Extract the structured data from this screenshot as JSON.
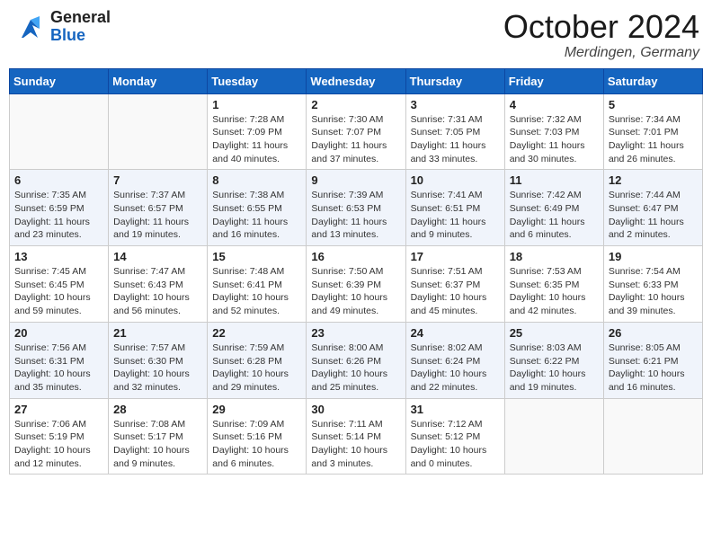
{
  "header": {
    "logo_general": "General",
    "logo_blue": "Blue",
    "month_title": "October 2024",
    "location": "Merdingen, Germany"
  },
  "days_of_week": [
    "Sunday",
    "Monday",
    "Tuesday",
    "Wednesday",
    "Thursday",
    "Friday",
    "Saturday"
  ],
  "weeks": [
    {
      "days": [
        {
          "num": "",
          "content": ""
        },
        {
          "num": "",
          "content": ""
        },
        {
          "num": "1",
          "content": "Sunrise: 7:28 AM\nSunset: 7:09 PM\nDaylight: 11 hours and 40 minutes."
        },
        {
          "num": "2",
          "content": "Sunrise: 7:30 AM\nSunset: 7:07 PM\nDaylight: 11 hours and 37 minutes."
        },
        {
          "num": "3",
          "content": "Sunrise: 7:31 AM\nSunset: 7:05 PM\nDaylight: 11 hours and 33 minutes."
        },
        {
          "num": "4",
          "content": "Sunrise: 7:32 AM\nSunset: 7:03 PM\nDaylight: 11 hours and 30 minutes."
        },
        {
          "num": "5",
          "content": "Sunrise: 7:34 AM\nSunset: 7:01 PM\nDaylight: 11 hours and 26 minutes."
        }
      ]
    },
    {
      "days": [
        {
          "num": "6",
          "content": "Sunrise: 7:35 AM\nSunset: 6:59 PM\nDaylight: 11 hours and 23 minutes."
        },
        {
          "num": "7",
          "content": "Sunrise: 7:37 AM\nSunset: 6:57 PM\nDaylight: 11 hours and 19 minutes."
        },
        {
          "num": "8",
          "content": "Sunrise: 7:38 AM\nSunset: 6:55 PM\nDaylight: 11 hours and 16 minutes."
        },
        {
          "num": "9",
          "content": "Sunrise: 7:39 AM\nSunset: 6:53 PM\nDaylight: 11 hours and 13 minutes."
        },
        {
          "num": "10",
          "content": "Sunrise: 7:41 AM\nSunset: 6:51 PM\nDaylight: 11 hours and 9 minutes."
        },
        {
          "num": "11",
          "content": "Sunrise: 7:42 AM\nSunset: 6:49 PM\nDaylight: 11 hours and 6 minutes."
        },
        {
          "num": "12",
          "content": "Sunrise: 7:44 AM\nSunset: 6:47 PM\nDaylight: 11 hours and 2 minutes."
        }
      ]
    },
    {
      "days": [
        {
          "num": "13",
          "content": "Sunrise: 7:45 AM\nSunset: 6:45 PM\nDaylight: 10 hours and 59 minutes."
        },
        {
          "num": "14",
          "content": "Sunrise: 7:47 AM\nSunset: 6:43 PM\nDaylight: 10 hours and 56 minutes."
        },
        {
          "num": "15",
          "content": "Sunrise: 7:48 AM\nSunset: 6:41 PM\nDaylight: 10 hours and 52 minutes."
        },
        {
          "num": "16",
          "content": "Sunrise: 7:50 AM\nSunset: 6:39 PM\nDaylight: 10 hours and 49 minutes."
        },
        {
          "num": "17",
          "content": "Sunrise: 7:51 AM\nSunset: 6:37 PM\nDaylight: 10 hours and 45 minutes."
        },
        {
          "num": "18",
          "content": "Sunrise: 7:53 AM\nSunset: 6:35 PM\nDaylight: 10 hours and 42 minutes."
        },
        {
          "num": "19",
          "content": "Sunrise: 7:54 AM\nSunset: 6:33 PM\nDaylight: 10 hours and 39 minutes."
        }
      ]
    },
    {
      "days": [
        {
          "num": "20",
          "content": "Sunrise: 7:56 AM\nSunset: 6:31 PM\nDaylight: 10 hours and 35 minutes."
        },
        {
          "num": "21",
          "content": "Sunrise: 7:57 AM\nSunset: 6:30 PM\nDaylight: 10 hours and 32 minutes."
        },
        {
          "num": "22",
          "content": "Sunrise: 7:59 AM\nSunset: 6:28 PM\nDaylight: 10 hours and 29 minutes."
        },
        {
          "num": "23",
          "content": "Sunrise: 8:00 AM\nSunset: 6:26 PM\nDaylight: 10 hours and 25 minutes."
        },
        {
          "num": "24",
          "content": "Sunrise: 8:02 AM\nSunset: 6:24 PM\nDaylight: 10 hours and 22 minutes."
        },
        {
          "num": "25",
          "content": "Sunrise: 8:03 AM\nSunset: 6:22 PM\nDaylight: 10 hours and 19 minutes."
        },
        {
          "num": "26",
          "content": "Sunrise: 8:05 AM\nSunset: 6:21 PM\nDaylight: 10 hours and 16 minutes."
        }
      ]
    },
    {
      "days": [
        {
          "num": "27",
          "content": "Sunrise: 7:06 AM\nSunset: 5:19 PM\nDaylight: 10 hours and 12 minutes."
        },
        {
          "num": "28",
          "content": "Sunrise: 7:08 AM\nSunset: 5:17 PM\nDaylight: 10 hours and 9 minutes."
        },
        {
          "num": "29",
          "content": "Sunrise: 7:09 AM\nSunset: 5:16 PM\nDaylight: 10 hours and 6 minutes."
        },
        {
          "num": "30",
          "content": "Sunrise: 7:11 AM\nSunset: 5:14 PM\nDaylight: 10 hours and 3 minutes."
        },
        {
          "num": "31",
          "content": "Sunrise: 7:12 AM\nSunset: 5:12 PM\nDaylight: 10 hours and 0 minutes."
        },
        {
          "num": "",
          "content": ""
        },
        {
          "num": "",
          "content": ""
        }
      ]
    }
  ]
}
